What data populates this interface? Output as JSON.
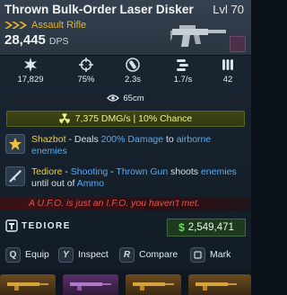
{
  "header": {
    "weapon_name": "Thrown Bulk-Order Laser Disker",
    "level": "Lvl 70",
    "weapon_type": "Assault Rifle",
    "dps_value": "28,445",
    "dps_label": "DPS",
    "rarity_color": "#e3b431"
  },
  "stats": [
    {
      "icon": "damage-icon",
      "value": "17,829"
    },
    {
      "icon": "accuracy-crosshair-icon",
      "value": "75%"
    },
    {
      "icon": "reload-time-icon",
      "value": "2.3s"
    },
    {
      "icon": "fire-rate-icon",
      "value": "1.7/s"
    },
    {
      "icon": "magazine-icon",
      "value": "42"
    }
  ],
  "accuracy": {
    "icon": "spread-icon",
    "value": "65cm"
  },
  "element": {
    "icon": "radiation-icon",
    "text": "7,375 DMG/s | 10% Chance",
    "color": "#e8f28a"
  },
  "perks": [
    {
      "icon": "shazbot-star-icon",
      "name": "Shazbot",
      "sep": " - Deals ",
      "hl1": "200% Damage",
      "mid": " to ",
      "hl2": "airborne enemies"
    },
    {
      "icon": "thrown-gun-icon",
      "name": "Tediore",
      "sep1": " - ",
      "hl1": "Shooting",
      "sep2": " - ",
      "hl2": "Thrown Gun",
      "mid": " shoots ",
      "hl3": "enemies",
      "mid2": " until out of ",
      "hl4": "Ammo"
    }
  ],
  "flavor": "A U.F.O. is just an I.F.O. you haven't met.",
  "manufacturer": "TEDIORE",
  "price": {
    "currency": "$",
    "value": "2,549,471"
  },
  "actions": [
    {
      "key": "Q",
      "label": "Equip"
    },
    {
      "key": "Y",
      "label": "Inspect"
    },
    {
      "key": "R",
      "label": "Compare"
    },
    {
      "key": "",
      "label": "Mark"
    }
  ],
  "colors": {
    "accent_yellow": "#f0cf3c",
    "accent_blue": "#5aaaf0",
    "flavor_red": "#e15353",
    "price_green": "#6fd45f"
  }
}
